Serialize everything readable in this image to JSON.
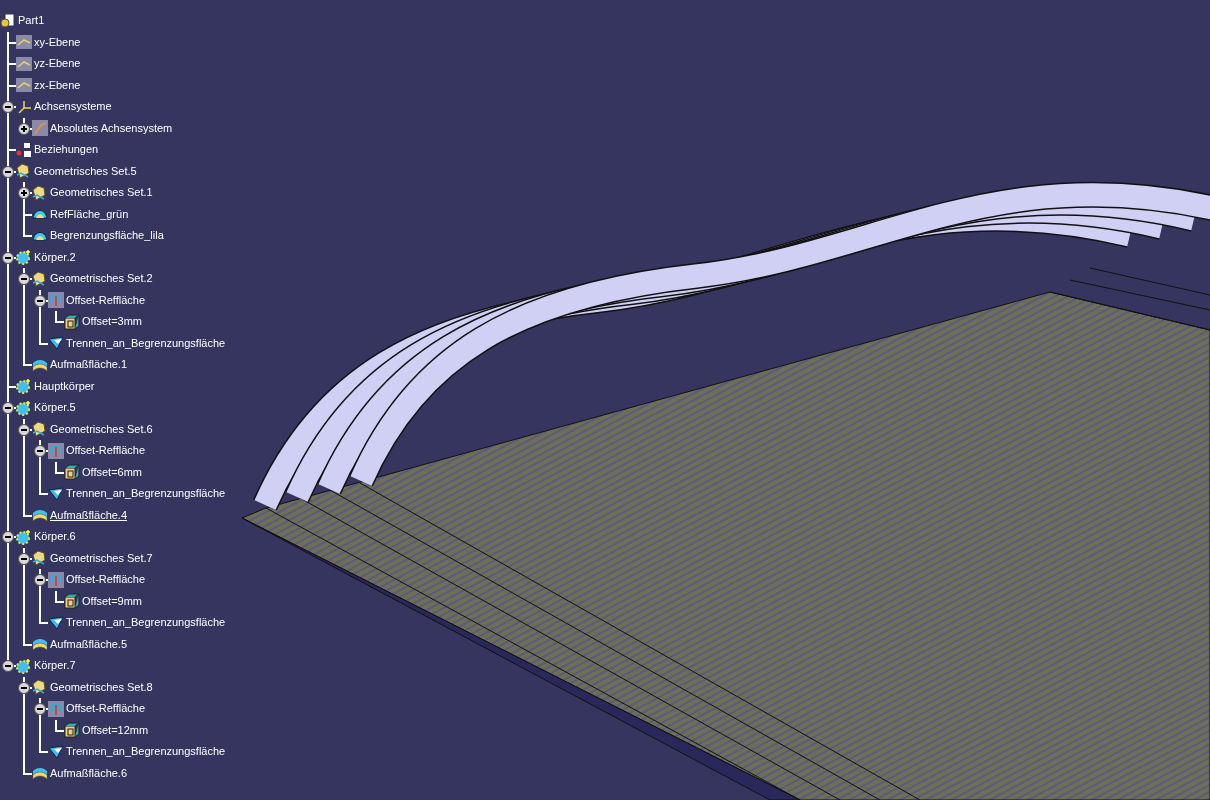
{
  "tree": {
    "label": "Part1",
    "kind": "part",
    "children": [
      {
        "label": "xy-Ebene",
        "kind": "plane"
      },
      {
        "label": "yz-Ebene",
        "kind": "plane"
      },
      {
        "label": "zx-Ebene",
        "kind": "plane"
      },
      {
        "label": "Achsensysteme",
        "kind": "axes",
        "expanded": true,
        "children": [
          {
            "label": "Absolutes Achsensystem",
            "kind": "axis-system",
            "expanded": false
          }
        ]
      },
      {
        "label": "Beziehungen",
        "kind": "relations"
      },
      {
        "label": "Geometrisches Set.5",
        "kind": "geoset",
        "expanded": true,
        "children": [
          {
            "label": "Geometrisches Set.1",
            "kind": "geoset",
            "expanded": false
          },
          {
            "label": "RefFläche_grün",
            "kind": "surface"
          },
          {
            "label": "Begrenzungsfläche_lila",
            "kind": "surface"
          }
        ]
      },
      {
        "label": "Körper.2",
        "kind": "body",
        "expanded": true,
        "children": [
          {
            "label": "Geometrisches Set.2",
            "kind": "geoset",
            "expanded": true,
            "children": [
              {
                "label": "Offset-Reffläche",
                "kind": "offset",
                "expanded": true,
                "children": [
                  {
                    "label": "Offset=3mm",
                    "kind": "parameter"
                  }
                ]
              },
              {
                "label": "Trennen_an_Begrenzungsfläche",
                "kind": "split"
              }
            ]
          },
          {
            "label": "Aufmaßfläche.1",
            "kind": "thick"
          }
        ]
      },
      {
        "label": "Hauptkörper",
        "kind": "body"
      },
      {
        "label": "Körper.5",
        "kind": "body",
        "expanded": true,
        "children": [
          {
            "label": "Geometrisches Set.6",
            "kind": "geoset",
            "expanded": true,
            "children": [
              {
                "label": "Offset-Reffläche",
                "kind": "offset",
                "expanded": true,
                "children": [
                  {
                    "label": "Offset=6mm",
                    "kind": "parameter"
                  }
                ]
              },
              {
                "label": "Trennen_an_Begrenzungsfläche",
                "kind": "split"
              }
            ]
          },
          {
            "label": "Aufmaßfläche.4",
            "kind": "thick",
            "current": true
          }
        ]
      },
      {
        "label": "Körper.6",
        "kind": "body",
        "expanded": true,
        "children": [
          {
            "label": "Geometrisches Set.7",
            "kind": "geoset",
            "expanded": true,
            "children": [
              {
                "label": "Offset-Reffläche",
                "kind": "offset",
                "expanded": true,
                "children": [
                  {
                    "label": "Offset=9mm",
                    "kind": "parameter"
                  }
                ]
              },
              {
                "label": "Trennen_an_Begrenzungsfläche",
                "kind": "split"
              }
            ]
          },
          {
            "label": "Aufmaßfläche.5",
            "kind": "thick"
          }
        ]
      },
      {
        "label": "Körper.7",
        "kind": "body",
        "expanded": true,
        "children": [
          {
            "label": "Geometrisches Set.8",
            "kind": "geoset",
            "expanded": true,
            "children": [
              {
                "label": "Offset-Reffläche",
                "kind": "offset",
                "expanded": true,
                "children": [
                  {
                    "label": "Offset=12mm",
                    "kind": "parameter"
                  }
                ]
              },
              {
                "label": "Trennen_an_Begrenzungsfläche",
                "kind": "split"
              }
            ]
          },
          {
            "label": "Aufmaßfläche.6",
            "kind": "thick"
          }
        ]
      }
    ]
  }
}
